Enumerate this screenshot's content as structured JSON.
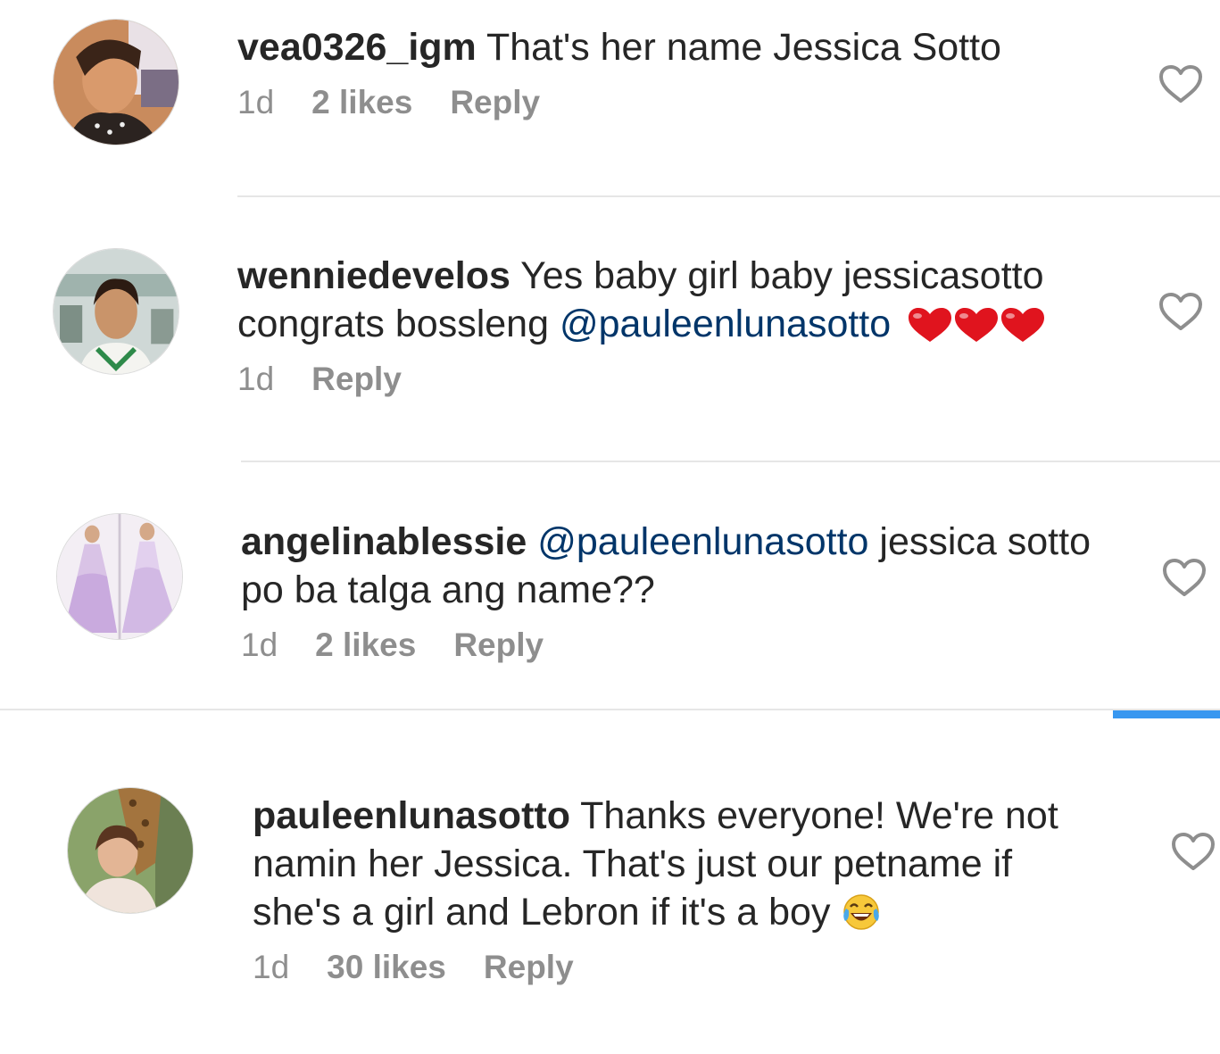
{
  "comments": [
    {
      "username": "vea0326_igm",
      "text": "That's her name Jessica Sotto",
      "time": "1d",
      "likes": "2 likes",
      "reply": "Reply"
    },
    {
      "username": "wenniedevelos",
      "text_line1": "Yes baby girl  baby jessicasotto",
      "text_line2": "congrats bossleng ",
      "mention": "@pauleenlunasotto",
      "time": "1d",
      "reply": "Reply"
    },
    {
      "username": "angelinablessie",
      "mention": "@pauleenlunasotto",
      "text_line1": " jessica sotto",
      "text_line2": "po ba talga ang name??",
      "time": "1d",
      "likes": "2 likes",
      "reply": "Reply"
    },
    {
      "username": "pauleenlunasotto",
      "text_line1": " Thanks everyone! We're not",
      "text_line2": "namin her Jessica. That's just our petname if",
      "text_line3": "she's a girl and Lebron if it's a boy ",
      "time": "1d",
      "likes": "30 likes",
      "reply": "Reply"
    }
  ],
  "icons": {
    "like": "heart-outline-icon",
    "emoji_hearts": "red-heart-emoji",
    "emoji_laugh": "tears-of-joy-emoji"
  },
  "colors": {
    "text": "#262626",
    "meta": "#8e8e8e",
    "mention": "#003569",
    "divider": "#e6e6e6",
    "accent": "#3897f0"
  }
}
